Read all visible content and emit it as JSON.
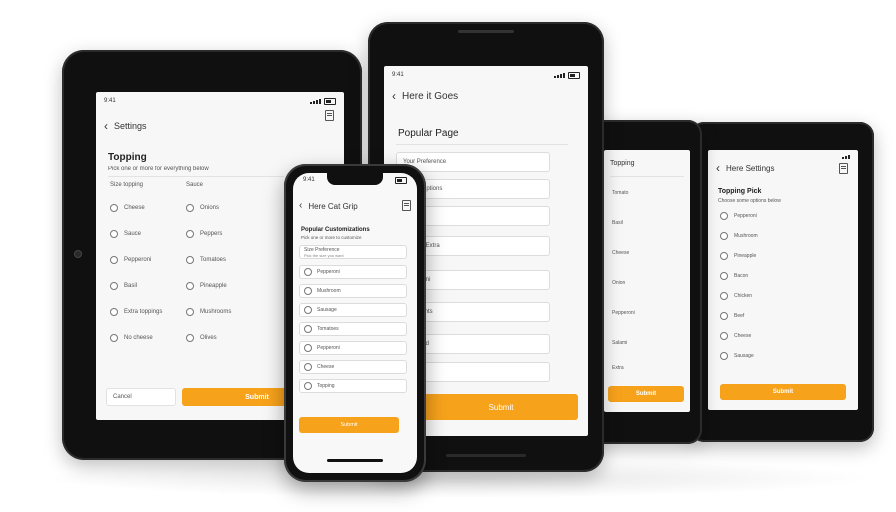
{
  "tablet_left": {
    "time": "9:41",
    "title": "Settings",
    "section_title": "Topping",
    "section_subtitle": "Pick one or more for everything below",
    "col_left_header": "Size topping",
    "col_right_header": "Sauce",
    "left_options": [
      "Cheese",
      "Sauce",
      "Pepperoni",
      "Basil",
      "Extra toppings",
      "No cheese"
    ],
    "right_options": [
      "Onions",
      "Peppers",
      "Tomatoes",
      "Pineapple",
      "Mushrooms",
      "Olives"
    ],
    "secondary_button": "Cancel",
    "primary_button": "Submit"
  },
  "tablet_center": {
    "time": "9:41",
    "title": "Here it Goes",
    "section_title": "Popular Page",
    "fields": [
      "Your Preference",
      "Sauce Options",
      "Topping",
      "Topping Extra",
      "Pepperoni",
      "Ingredients",
      "Extra Add",
      "Extra"
    ],
    "primary_button": "Submit"
  },
  "phone": {
    "time": "9:41",
    "title": "Here Cat Grip",
    "section_title": "Popular Customizations",
    "section_subtitle": "Pick one or more to customize",
    "field_top": "Size Preference",
    "field_top_hint": "Pick the size you want",
    "options": [
      "Pepperoni",
      "Mushroom",
      "Sausage",
      "Tomatoes",
      "Pepperoni",
      "Cheese",
      "Topping"
    ],
    "primary_button": "Submit"
  },
  "tablet_right_a": {
    "title": "Topping",
    "items": [
      "Tomato",
      "Basil",
      "Cheese",
      "Onion",
      "Pepperoni",
      "Salami",
      "Extra"
    ],
    "primary_button": "Submit"
  },
  "tablet_right_b": {
    "title": "Here Settings",
    "section_title": "Topping Pick",
    "section_subtitle": "Choose some options below",
    "items": [
      "Pepperoni",
      "Mushroom",
      "Pineapple",
      "Bacon",
      "Chicken",
      "Beef",
      "Cheese",
      "Sausage"
    ],
    "primary_button": "Submit"
  },
  "colors": {
    "accent": "#f7a21b",
    "bezel": "#101010",
    "screen": "#f7f7f7"
  }
}
